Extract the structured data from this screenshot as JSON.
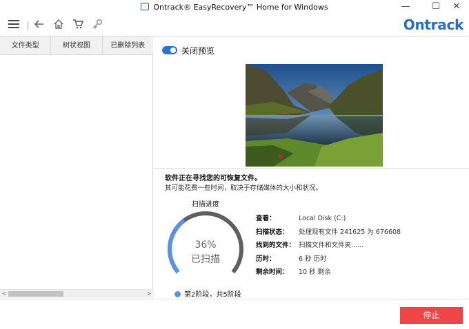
{
  "window": {
    "title": "Ontrack® EasyRecovery™ Home for Windows",
    "minimize_glyph": "—",
    "maximize_glyph": "☐",
    "close_glyph": "✕"
  },
  "toolbar": {
    "logo": "Ontrack",
    "icons": [
      "menu-icon",
      "back-icon",
      "home-icon",
      "cart-icon",
      "key-icon"
    ]
  },
  "left_panel": {
    "tabs": [
      "文件类型",
      "树状视图",
      "已删除列表"
    ],
    "scroll_left": "<",
    "scroll_right": ">"
  },
  "preview": {
    "toggle_label": "关闭预览",
    "toggle_on": true
  },
  "status": {
    "title": "软件正在寻找您的可恢复文件。",
    "subtitle": "其可能花费一些时间，取决于存储媒体的大小和状况。",
    "progress_label": "扫描进度",
    "progress_percent": 36,
    "progress_text": "36%",
    "progress_state": "已扫描",
    "stage": "第2阶段，共5阶段",
    "details": [
      {
        "key": "查看：",
        "value": "Local Disk (C:)"
      },
      {
        "key": "扫描状态：",
        "value": "处理现有文件 241625 为 676608"
      },
      {
        "key": "找到的文件：",
        "value": "扫描文件和文件夹......"
      },
      {
        "key": "历时：",
        "value": "6 秒 历时"
      },
      {
        "key": "剩余时间：",
        "value": "10 秒 剩余"
      }
    ]
  },
  "footer": {
    "stop_label": "停止",
    "stop_color": "#ef4545"
  },
  "colors": {
    "accent": "#2d72d9",
    "gauge": "#5b8fe8",
    "gauge_track": "#5f5f5f"
  }
}
